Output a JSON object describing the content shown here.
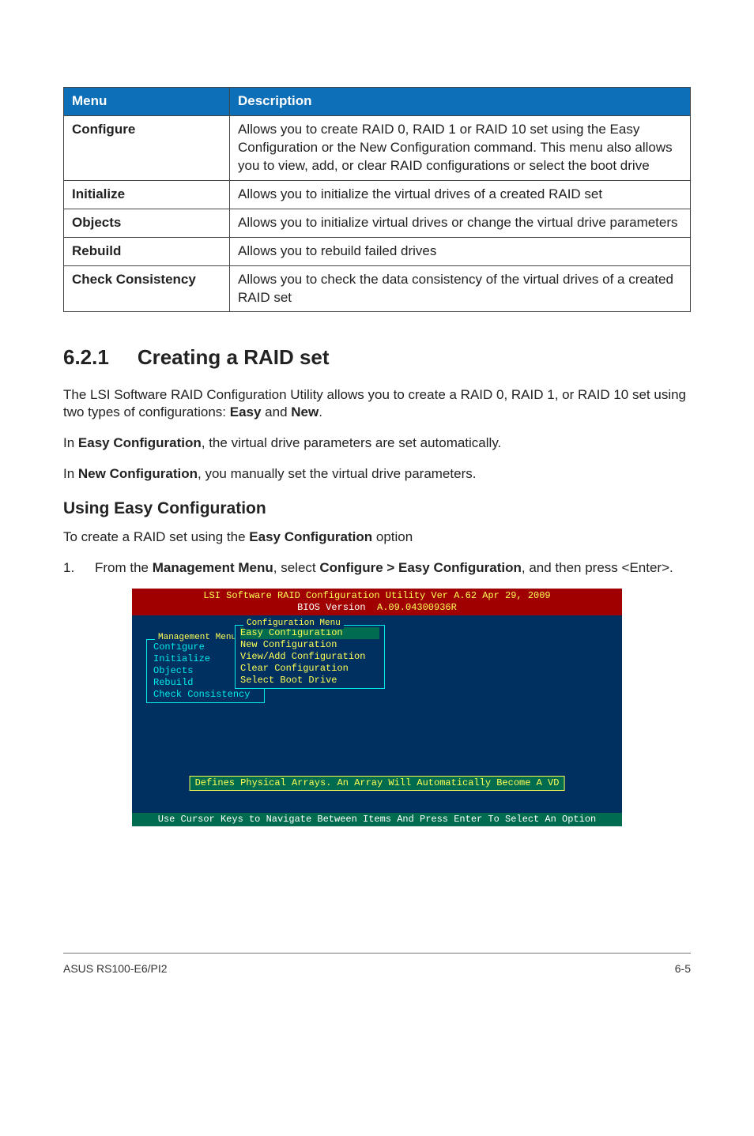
{
  "table": {
    "headers": {
      "menu": "Menu",
      "desc": "Description"
    },
    "rows": [
      {
        "menu": "Configure",
        "desc": "Allows you to create RAID 0, RAID 1 or RAID 10 set using the Easy Configuration or the New Configuration command. This menu also allows you to view, add, or clear RAID configurations or select the boot drive"
      },
      {
        "menu": "Initialize",
        "desc": "Allows you to initialize the virtual drives of a created RAID set"
      },
      {
        "menu": "Objects",
        "desc": "Allows you to initialize virtual drives or change the virtual drive parameters"
      },
      {
        "menu": "Rebuild",
        "desc": "Allows you to rebuild failed drives"
      },
      {
        "menu": "Check Consistency",
        "desc": "Allows you to check the data consistency of the virtual drives of a created RAID set"
      }
    ]
  },
  "section": {
    "number": "6.2.1",
    "title": "Creating a RAID set",
    "p1_a": "The LSI Software RAID Configuration Utility allows you to create a RAID 0, RAID 1, or RAID 10 set using two types of configurations: ",
    "p1_easy": "Easy",
    "p1_and": " and ",
    "p1_new": "New",
    "p1_end": ".",
    "p2_a": "In ",
    "p2_b": "Easy Configuration",
    "p2_c": ", the virtual drive parameters are set automatically.",
    "p3_a": "In ",
    "p3_b": "New Configuration",
    "p3_c": ", you manually set the virtual drive parameters."
  },
  "subhead": "Using Easy Configuration",
  "sub_p_a": "To create a RAID set using the ",
  "sub_p_b": "Easy Configuration",
  "sub_p_c": " option",
  "step1": {
    "num": "1.",
    "a": "From the ",
    "b": "Management Menu",
    "c": ", select ",
    "d": "Configure > Easy Configuration",
    "e": ", and then press <Enter>."
  },
  "bios": {
    "header_line1_a": "LSI Software RAID Configuration Utility Ver A.62 Apr 29, 2009",
    "header_line2_a": "BIOS Version  ",
    "header_line2_b": "A.09.04300936R",
    "mgmt_title": "Management Menu",
    "mgmt_items": [
      "Configure",
      "Initialize",
      "Objects",
      "Rebuild",
      "Check Consistency"
    ],
    "cfg_title": "Configuration Menu",
    "cfg_items": [
      "Easy Configuration",
      "New Configuration",
      "View/Add Configuration",
      "Clear Configuration",
      "Select Boot Drive"
    ],
    "hint": "Defines Physical Arrays. An Array Will Automatically Become A VD",
    "footer": "Use Cursor Keys to Navigate Between Items And Press Enter To Select An Option"
  },
  "page_footer": {
    "left": "ASUS RS100-E6/PI2",
    "right": "6-5"
  }
}
